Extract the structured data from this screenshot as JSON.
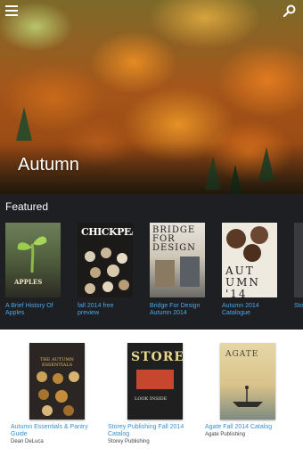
{
  "hero": {
    "title": "Autumn",
    "menu_icon": "menu-icon",
    "search_icon": "search-icon"
  },
  "featured": {
    "title": "Featured",
    "items": [
      {
        "label": "A Brief History Of Apples",
        "cover_text": "APPLES"
      },
      {
        "label": "fall 2014 free preview",
        "cover_text": "CHICKPEA"
      },
      {
        "label": "Bridge For Design Autumn 2014",
        "cover_text": "BRIDGE FOR DESIGN"
      },
      {
        "label": "Autumn 2014 Catalogue",
        "cover_text": "AUT UMN '14"
      },
      {
        "label": "Sto Fal",
        "cover_text": ""
      }
    ]
  },
  "lower": {
    "items": [
      {
        "title": "Autumn Essentials & Pantry Guide",
        "publisher": "Dean DeLuca",
        "cover_text": "THE AUTUMN ESSENTIALS"
      },
      {
        "title": "Storey Publishing Fall 2014 Catalog",
        "publisher": "Storey Publishing",
        "cover_text": "STOREY",
        "cover_sub": "LOOK INSIDE"
      },
      {
        "title": "Agate Fall 2014 Catalog",
        "publisher": "Agate Publishing",
        "cover_text": "AGATE"
      }
    ]
  }
}
